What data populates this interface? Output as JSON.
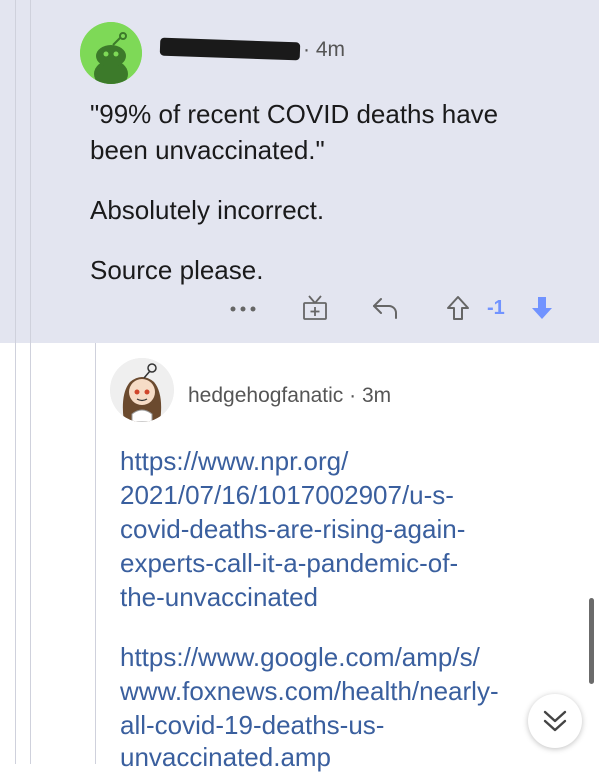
{
  "comment": {
    "time": "4m",
    "paragraphs": [
      "\"99% of recent COVID deaths have",
      "been unvaccinated.\"",
      "Absolutely incorrect.",
      "Source please."
    ],
    "score": "-1",
    "icons": [
      "more-icon",
      "gift-icon",
      "reply-icon",
      "upvote-icon",
      "downvote-icon"
    ]
  },
  "reply": {
    "username": "hedgehogfanatic",
    "time": "3m",
    "link1_lines": [
      "https://www.npr.org/",
      "2021/07/16/1017002907/u-s-",
      "covid-deaths-are-rising-again-",
      "experts-call-it-a-pandemic-of-",
      "the-unvaccinated"
    ],
    "link2_lines": [
      "https://www.google.com/amp/s/",
      "www.foxnews.com/health/nearly-",
      "all-covid-19-deaths-us-",
      "unvaccinated.amp"
    ]
  },
  "colors": {
    "upvote": "#7193ff",
    "link": "#3a5f9e",
    "background_top": "#e3e5f0"
  },
  "dot": "·"
}
